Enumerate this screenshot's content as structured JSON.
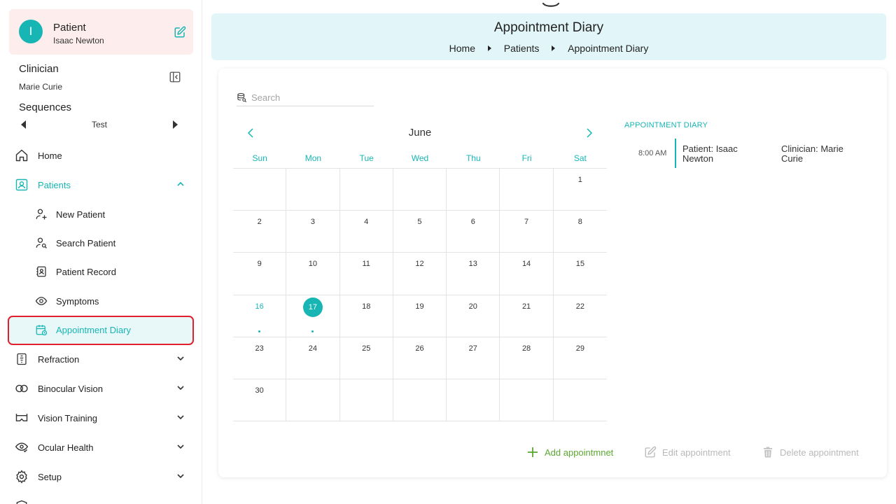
{
  "patient_card": {
    "title": "Patient",
    "name": "Isaac Newton",
    "avatar_letter": "I"
  },
  "clinician": {
    "title": "Clinician",
    "name": "Marie Curie"
  },
  "sequences": {
    "title": "Sequences",
    "value": "Test"
  },
  "nav": {
    "home": "Home",
    "patients": "Patients",
    "patients_sub": {
      "new_patient": "New Patient",
      "search_patient": "Search Patient",
      "patient_record": "Patient Record",
      "symptoms": "Symptoms",
      "appointment_diary": "Appointment Diary"
    },
    "refraction": "Refraction",
    "binocular_vision": "Binocular Vision",
    "vision_training": "Vision Training",
    "ocular_health": "Ocular Health",
    "setup": "Setup"
  },
  "header": {
    "title": "Appointment Diary",
    "breadcrumb": [
      "Home",
      "Patients",
      "Appointment Diary"
    ]
  },
  "search": {
    "placeholder": "Search",
    "value": ""
  },
  "calendar": {
    "month": "June",
    "weekdays": [
      "Sun",
      "Mon",
      "Tue",
      "Wed",
      "Thu",
      "Fri",
      "Sat"
    ],
    "leading_blanks": 6,
    "days_in_month": 30,
    "today": 17,
    "highlighted_day": 16,
    "days_with_events": [
      16,
      17
    ]
  },
  "diary": {
    "title": "APPOINTMENT DIARY",
    "appointments": [
      {
        "time": "8:00 AM",
        "patient": "Patient: Isaac Newton",
        "clinician": "Clinician: Marie Curie"
      }
    ]
  },
  "actions": {
    "add": "Add appointmnet",
    "edit": "Edit appointment",
    "delete": "Delete appointment"
  },
  "colors": {
    "accent": "#17b6b4",
    "add_green": "#5aa832",
    "selection_red": "#e0202a",
    "header_bg": "#e2f5f8",
    "patient_card_bg": "#fdeeed"
  }
}
